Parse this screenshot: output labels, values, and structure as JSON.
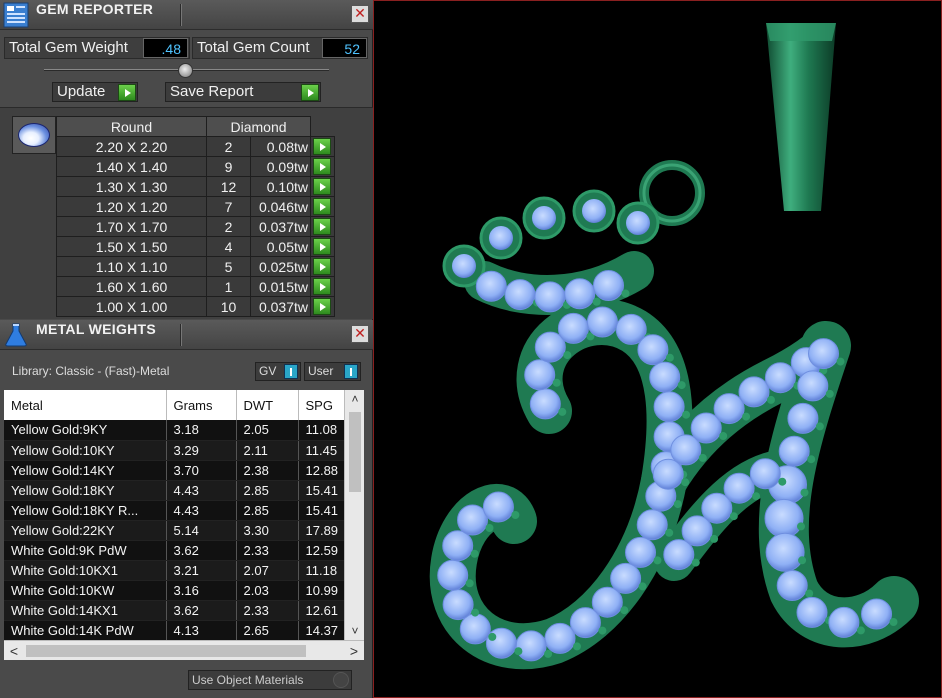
{
  "gem_reporter": {
    "title": "GEM REPORTER",
    "total_weight_label": "Total Gem Weight",
    "total_weight_value": ".48",
    "total_count_label": "Total Gem Count",
    "total_count_value": "52",
    "update_label": "Update",
    "save_report_label": "Save Report",
    "close_glyph": "✕",
    "table_headers": {
      "shape": "Round",
      "material": "Diamond"
    },
    "rows": [
      {
        "size": "2.20 X 2.20",
        "count": "2",
        "weight": "0.08tw"
      },
      {
        "size": "1.40 X 1.40",
        "count": "9",
        "weight": "0.09tw"
      },
      {
        "size": "1.30 X 1.30",
        "count": "12",
        "weight": "0.10tw"
      },
      {
        "size": "1.20 X 1.20",
        "count": "7",
        "weight": "0.046tw"
      },
      {
        "size": "1.70 X 1.70",
        "count": "2",
        "weight": "0.037tw"
      },
      {
        "size": "1.50 X 1.50",
        "count": "4",
        "weight": "0.05tw"
      },
      {
        "size": "1.10 X 1.10",
        "count": "5",
        "weight": "0.025tw"
      },
      {
        "size": "1.60 X 1.60",
        "count": "1",
        "weight": "0.015tw"
      },
      {
        "size": "1.00 X 1.00",
        "count": "10",
        "weight": "0.037tw"
      }
    ]
  },
  "metal_weights": {
    "title": "METAL WEIGHTS",
    "library_label": "Library: Classic - (Fast)-Metal",
    "gv_label": "GV",
    "user_label": "User",
    "close_glyph": "✕",
    "columns": [
      "Metal",
      "Grams",
      "DWT",
      "SPG"
    ],
    "rows": [
      [
        "Yellow Gold:9KY",
        "3.18",
        "2.05",
        "11.08"
      ],
      [
        "Yellow Gold:10KY",
        "3.29",
        "2.11",
        "11.45"
      ],
      [
        "Yellow Gold:14KY",
        "3.70",
        "2.38",
        "12.88"
      ],
      [
        "Yellow Gold:18KY",
        "4.43",
        "2.85",
        "15.41"
      ],
      [
        "Yellow Gold:18KY R...",
        "4.43",
        "2.85",
        "15.41"
      ],
      [
        "Yellow Gold:22KY",
        "5.14",
        "3.30",
        "17.89"
      ],
      [
        "White Gold:9K PdW",
        "3.62",
        "2.33",
        "12.59"
      ],
      [
        "White Gold:10KX1",
        "3.21",
        "2.07",
        "11.18"
      ],
      [
        "White Gold:10KW",
        "3.16",
        "2.03",
        "10.99"
      ],
      [
        "White Gold:14KX1",
        "3.62",
        "2.33",
        "12.61"
      ],
      [
        "White Gold:14K PdW",
        "4.13",
        "2.65",
        "14.37"
      ]
    ],
    "scroll": {
      "up": "˄",
      "down": "˅",
      "left": "<",
      "right": ">"
    },
    "use_object_materials_label": "Use Object Materials"
  },
  "viewport": {
    "colors": {
      "metal": "#1f7a52",
      "stone": "#8fb6ff",
      "background": "#000000"
    }
  }
}
